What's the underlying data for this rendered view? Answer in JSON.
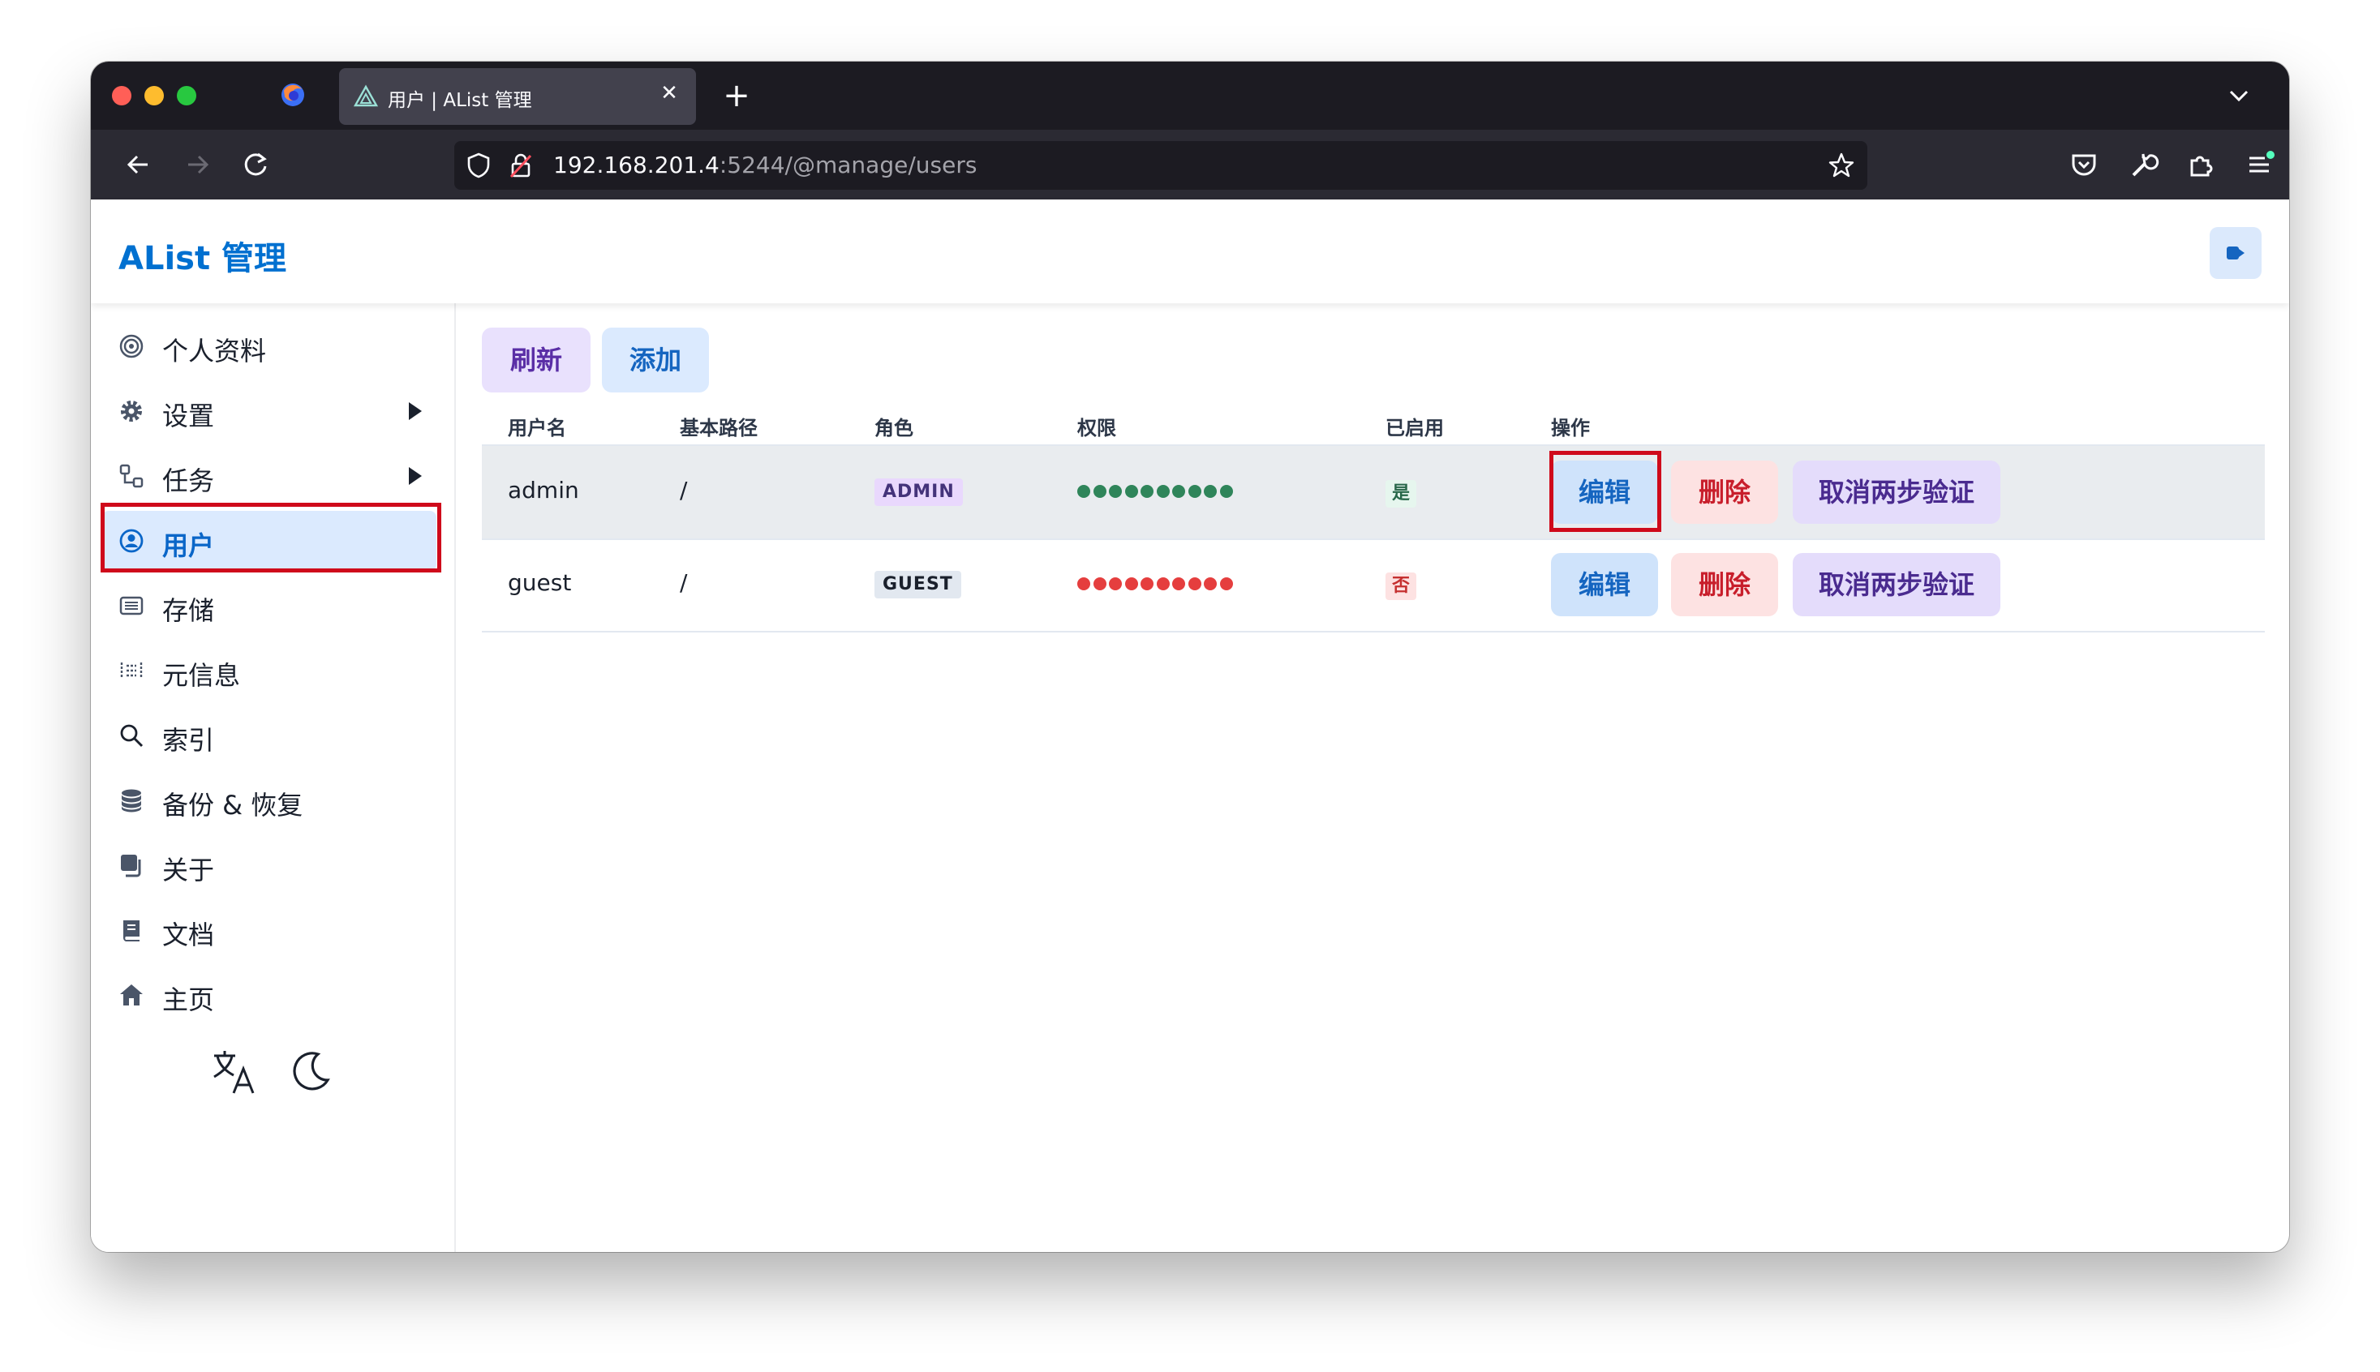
{
  "browser": {
    "tab_title": "用户 | AList 管理",
    "new_tab": "+",
    "close_tab": "✕",
    "url_host": "192.168.201.4",
    "url_path": ":5244/@manage/users"
  },
  "header": {
    "title": "AList 管理"
  },
  "sidebar": {
    "items": [
      {
        "label": "个人资料",
        "icon": "fingerprint-icon"
      },
      {
        "label": "设置",
        "icon": "gear-icon",
        "expandable": true
      },
      {
        "label": "任务",
        "icon": "tasks-icon",
        "expandable": true
      },
      {
        "label": "用户",
        "icon": "user-circle-icon",
        "active": true
      },
      {
        "label": "存储",
        "icon": "storage-icon"
      },
      {
        "label": "元信息",
        "icon": "meta-icon"
      },
      {
        "label": "索引",
        "icon": "search-icon"
      },
      {
        "label": "备份 & 恢复",
        "icon": "database-icon"
      },
      {
        "label": "关于",
        "icon": "copy-icon"
      },
      {
        "label": "文档",
        "icon": "book-icon"
      },
      {
        "label": "主页",
        "icon": "home-icon"
      }
    ]
  },
  "toolbar": {
    "refresh_label": "刷新",
    "add_label": "添加"
  },
  "table": {
    "columns": [
      "用户名",
      "基本路径",
      "角色",
      "权限",
      "已启用",
      "操作"
    ],
    "rows": [
      {
        "username": "admin",
        "base_path": "/",
        "role": "ADMIN",
        "permissions": "all-granted",
        "enabled": "是",
        "actions": [
          "编辑",
          "删除",
          "取消两步验证"
        ]
      },
      {
        "username": "guest",
        "base_path": "/",
        "role": "GUEST",
        "permissions": "none-granted",
        "enabled": "否",
        "actions": [
          "编辑",
          "删除",
          "取消两步验证"
        ]
      }
    ]
  },
  "colors": {
    "brand": "#0070d0",
    "active_bg": "#dbeafe",
    "highlight_border": "#cf0a1b",
    "perm_granted": "#2f855a",
    "perm_denied": "#e53e3e"
  }
}
